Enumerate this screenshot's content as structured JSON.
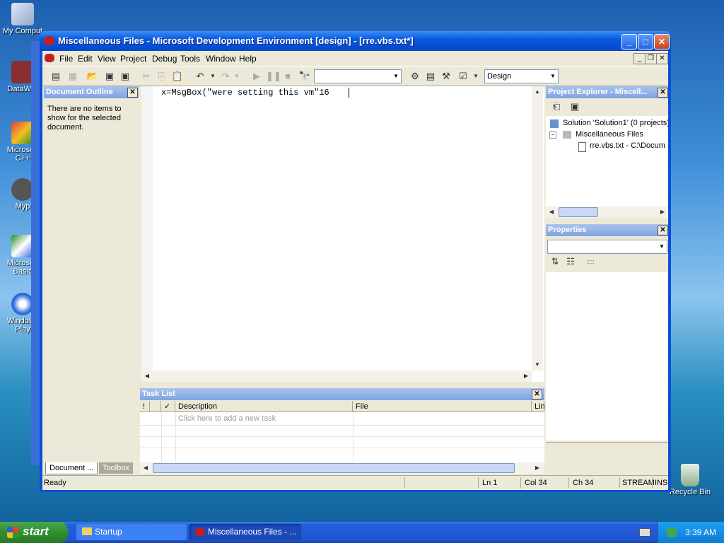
{
  "desktop": {
    "icons": [
      {
        "label": "My Comput"
      },
      {
        "label": "DataWar"
      },
      {
        "label": "Microsoft C++"
      },
      {
        "label": "Myp"
      },
      {
        "label": "Microsoft Basic"
      },
      {
        "label": "Windows Play"
      }
    ],
    "recycle_bin": "Recycle Bin"
  },
  "window": {
    "title": "Miscellaneous Files - Microsoft Development Environment [design] - [rre.vbs.txt*]",
    "menu": [
      "File",
      "Edit",
      "View",
      "Project",
      "Debug",
      "Tools",
      "Window",
      "Help"
    ],
    "toolbar": {
      "find_combo_value": "",
      "config_combo_value": "Design"
    },
    "document_outline": {
      "title": "Document Outline",
      "message": "There are no items to show for the selected document."
    },
    "tabs": [
      "Document ...",
      "Toolbox"
    ],
    "editor": {
      "code_line": "x=MsgBox(\"were setting this vm\"16"
    },
    "task_list": {
      "title": "Task List",
      "columns": [
        "!",
        "",
        "✓",
        "Description",
        "File",
        "Lin"
      ],
      "placeholder_row": "Click here to add a new task"
    },
    "project_explorer": {
      "title": "Project Explorer - Miscell...",
      "solution": "Solution 'Solution1' (0 projects)",
      "folder": "Miscellaneous Files",
      "file": "rre.vbs.txt - C:\\Docum"
    },
    "properties": {
      "title": "Properties",
      "combo_value": ""
    },
    "status": {
      "ready": "Ready",
      "ln": "Ln 1",
      "col": "Col 34",
      "ch": "Ch 34",
      "stream": "STREAM",
      "ins": "INS"
    }
  },
  "taskbar": {
    "start": "start",
    "items": [
      "Startup",
      "Miscellaneous Files - ..."
    ],
    "clock": "3:39 AM"
  },
  "colors": {
    "title_blue": "#0546c8",
    "panel_title_blue": "#7ea3e2",
    "start_green": "#2f8f2f",
    "face": "#ece9d8"
  }
}
